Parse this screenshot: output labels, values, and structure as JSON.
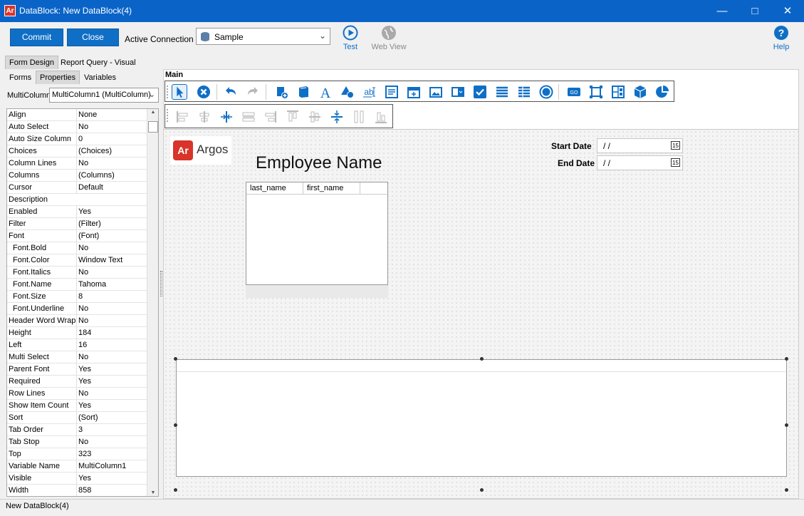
{
  "window": {
    "title": "DataBlock: New DataBlock(4)",
    "app_icon": "Ar",
    "accent": "#0a64c8"
  },
  "toolbar": {
    "commit_label": "Commit",
    "close_label": "Close",
    "active_connection_label": "Active Connection",
    "connection_value": "Sample",
    "test_label": "Test",
    "webview_label": "Web View",
    "help_label": "Help"
  },
  "tabs": {
    "form_design": "Form Design",
    "report_query": "Report Query - Visual Design"
  },
  "subtabs": {
    "forms": "Forms",
    "properties": "Properties",
    "variables": "Variables"
  },
  "selector": {
    "label": "MultiColumn",
    "value": "MultiColumn1 (MultiColumn)"
  },
  "properties": [
    {
      "name": "Align",
      "value": "None"
    },
    {
      "name": "Auto Select",
      "value": "No"
    },
    {
      "name": "Auto Size Column",
      "value": "0"
    },
    {
      "name": "Choices",
      "value": "(Choices)"
    },
    {
      "name": "Column Lines",
      "value": "No"
    },
    {
      "name": "Columns",
      "value": "(Columns)"
    },
    {
      "name": "Cursor",
      "value": "Default"
    },
    {
      "name": "Description",
      "value": ""
    },
    {
      "name": "Enabled",
      "value": "Yes"
    },
    {
      "name": "Filter",
      "value": "(Filter)"
    },
    {
      "name": "Font",
      "value": "(Font)"
    },
    {
      "name": "Font.Bold",
      "value": "No"
    },
    {
      "name": "Font.Color",
      "value": "Window Text"
    },
    {
      "name": "Font.Italics",
      "value": "No"
    },
    {
      "name": "Font.Name",
      "value": "Tahoma"
    },
    {
      "name": "Font.Size",
      "value": "8"
    },
    {
      "name": "Font.Underline",
      "value": "No"
    },
    {
      "name": "Header Word Wrap",
      "value": "No"
    },
    {
      "name": "Height",
      "value": "184"
    },
    {
      "name": "Left",
      "value": "16"
    },
    {
      "name": "Multi Select",
      "value": "No"
    },
    {
      "name": "Parent Font",
      "value": "Yes"
    },
    {
      "name": "Required",
      "value": "Yes"
    },
    {
      "name": "Row Lines",
      "value": "No"
    },
    {
      "name": "Show Item Count",
      "value": "Yes"
    },
    {
      "name": "Sort",
      "value": "(Sort)"
    },
    {
      "name": "Tab Order",
      "value": "3"
    },
    {
      "name": "Tab Stop",
      "value": "No"
    },
    {
      "name": "Top",
      "value": "323"
    },
    {
      "name": "Variable Name",
      "value": "MultiColumn1"
    },
    {
      "name": "Visible",
      "value": "Yes"
    },
    {
      "name": "Width",
      "value": "858"
    }
  ],
  "designer": {
    "toolbar_label": "Main",
    "logo_mark": "Ar",
    "logo_text": "Argos",
    "employee_title": "Employee Name",
    "start_date_label": "Start Date",
    "start_date_value": "/ /",
    "end_date_label": "End Date",
    "end_date_value": "/ /",
    "calendar_glyph": "15",
    "grid_columns": [
      "last_name",
      "first_name"
    ]
  },
  "status": {
    "text": "New DataBlock(4)"
  }
}
